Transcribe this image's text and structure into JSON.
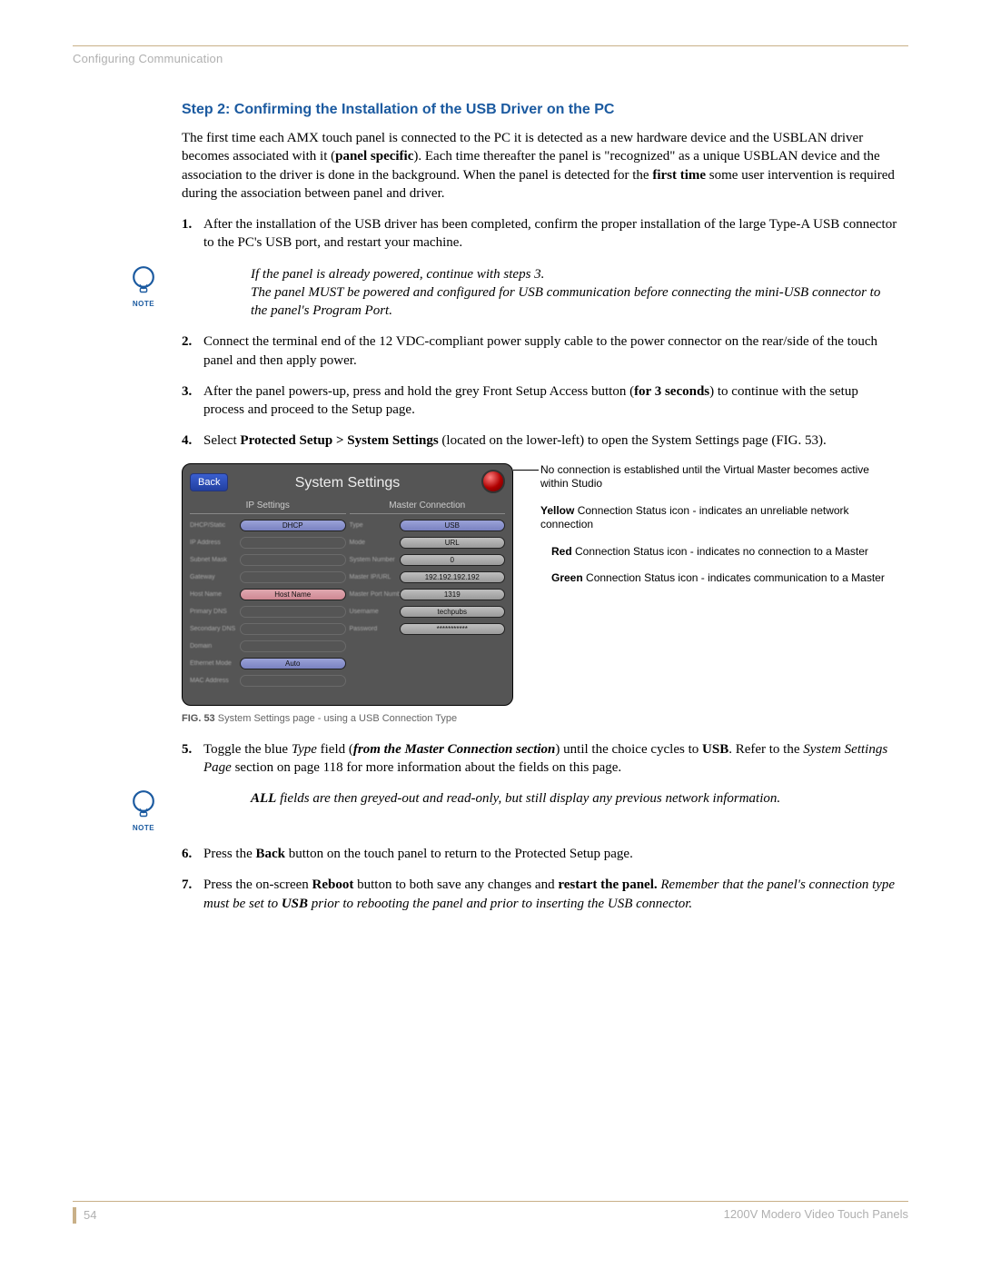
{
  "header": {
    "section": "Configuring Communication"
  },
  "title": "Step 2: Confirming the Installation of the USB Driver on the PC",
  "intro": {
    "s1": "The first time each AMX touch panel is connected to the PC it is detected as a new hardware device and the USBLAN driver becomes associated with it (",
    "b1": "panel specific",
    "s2": "). Each time thereafter the panel is \"recognized\" as a unique USBLAN device and the association to the driver is done in the background. When the panel is detected for the ",
    "b2": "first time",
    "s3": " some user intervention is required during the association between panel and driver."
  },
  "steps": {
    "1": "After the installation of the USB driver has been completed, confirm the proper installation of the large Type-A USB connector to the PC's USB port, and restart your machine.",
    "2": "Connect the terminal end of the 12 VDC-compliant power supply cable to the power connector on the rear/side of the touch panel and then apply power.",
    "3": {
      "a": "After the panel powers-up, press and hold the grey Front Setup Access button (",
      "b": "for 3 seconds",
      "c": ") to continue with the setup process and proceed to the Setup page."
    },
    "4": {
      "a": "Select ",
      "b": "Protected Setup > System Settings",
      "c": " (located on the lower-left) to open the System Settings page (FIG. 53)."
    },
    "5": {
      "a": "Toggle the blue ",
      "i1": "Type",
      "b": " field (",
      "bi": "from the Master Connection section",
      "c": ") until the choice cycles to ",
      "b2": "USB",
      "d": ". Refer to the ",
      "i2": "System Settings Page",
      "e": " section on page 118 for more information about the fields on this page."
    },
    "6": {
      "a": "Press the ",
      "b": "Back",
      "c": " button on the touch panel to return to the Protected Setup page."
    },
    "7": {
      "a": "Press the on-screen ",
      "b": "Reboot",
      "c": " button to both save any changes and ",
      "b2": "restart the panel.",
      "d": " ",
      "i1": "Remember that the panel's connection type must be set to ",
      "bi": "USB",
      "i2": " prior to rebooting the panel and prior to inserting the USB connector."
    }
  },
  "note1": {
    "l1": "If the panel is already powered, continue with steps 3.",
    "l2": "The panel MUST be powered and configured for USB communication before connecting the mini-USB connector to the panel's Program Port."
  },
  "note2": {
    "a": "ALL",
    "b": " fields are then greyed-out and read-only, but still display any previous network information."
  },
  "note_label": "NOTE",
  "figure": {
    "title": "System Settings",
    "back": "Back",
    "col1_h": "IP Settings",
    "col2_h": "Master Connection",
    "ip": {
      "labels": [
        "DHCP/Static",
        "IP Address",
        "Subnet Mask",
        "Gateway",
        "Host Name",
        "Primary DNS",
        "Secondary DNS",
        "Domain",
        "Ethernet Mode",
        "MAC Address"
      ],
      "vals": [
        "DHCP",
        "",
        "",
        "",
        "Host Name",
        "",
        "",
        "",
        "Auto",
        ""
      ]
    },
    "master": {
      "labels": [
        "Type",
        "Mode",
        "System Number",
        "Master IP/URL",
        "Master Port Number",
        "Username",
        "Password"
      ],
      "vals": [
        "USB",
        "URL",
        "0",
        "192.192.192.192",
        "1319",
        "techpubs",
        "***********"
      ]
    },
    "callouts": {
      "c0": "No connection is established until the Virtual Master becomes active within Studio",
      "c1a": "Yellow",
      "c1b": " Connection Status icon - indicates an unreliable network connection",
      "c2a": "Red",
      "c2b": " Connection Status icon - indicates no connection to a Master",
      "c3a": "Green",
      "c3b": " Connection Status icon - indicates communication to a Master"
    },
    "caption_a": "FIG. 53",
    "caption_b": "  System Settings page - using a USB Connection Type"
  },
  "footer": {
    "page": "54",
    "doc": "1200V Modero Video Touch Panels"
  }
}
